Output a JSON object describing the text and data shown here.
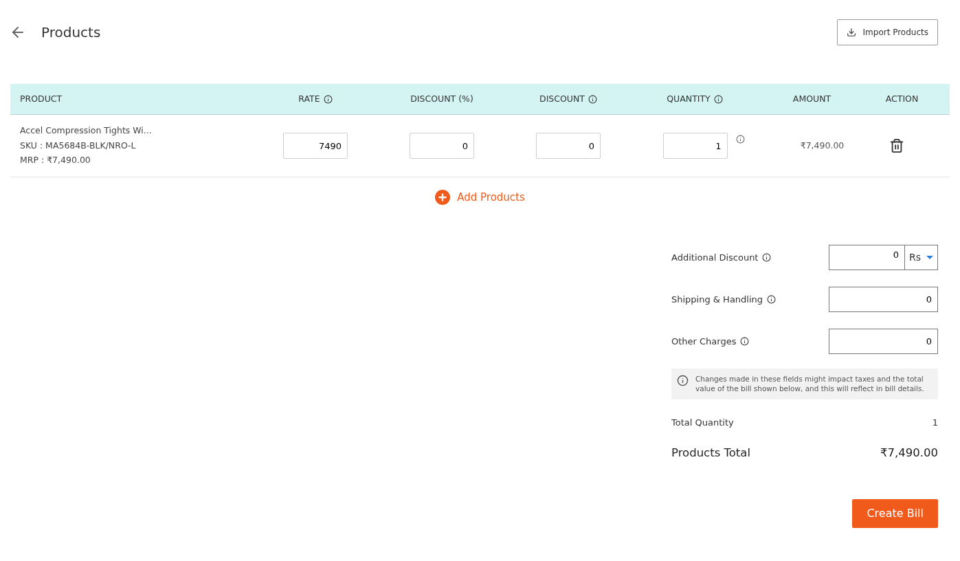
{
  "header": {
    "title": "Products",
    "import_button": "Import Products"
  },
  "table": {
    "columns": [
      {
        "label": "PRODUCT",
        "info": false
      },
      {
        "label": "RATE",
        "info": true
      },
      {
        "label": "DISCOUNT (%)",
        "info": false
      },
      {
        "label": "DISCOUNT",
        "info": true
      },
      {
        "label": "QUANTITY",
        "info": true
      },
      {
        "label": "AMOUNT",
        "info": false
      },
      {
        "label": "ACTION",
        "info": false
      }
    ],
    "rows": [
      {
        "name": "Accel Compression Tights Wi...",
        "sku": "SKU : MA5684B-BLK/NRO-L",
        "mrp": "MRP : ₹7,490.00",
        "rate": "7490",
        "discount_percent": "0",
        "discount": "0",
        "quantity": "1",
        "amount": "₹7,490.00"
      }
    ]
  },
  "add_products": "Add Products",
  "charges": [
    {
      "label": "Additional Discount",
      "value": "0",
      "unit": "Rs"
    },
    {
      "label": "Shipping & Handling",
      "value": "0"
    },
    {
      "label": "Other Charges",
      "value": "0"
    }
  ],
  "notice": "Changes made in these fields might impact taxes and the total value of the bill shown below, and this will reflect in bill details.",
  "total_quantity": {
    "label": "Total Quantity",
    "value": "1"
  },
  "products_total": {
    "label": "Products Total",
    "value": "₹7,490.00"
  },
  "create_button": "Create Bill"
}
